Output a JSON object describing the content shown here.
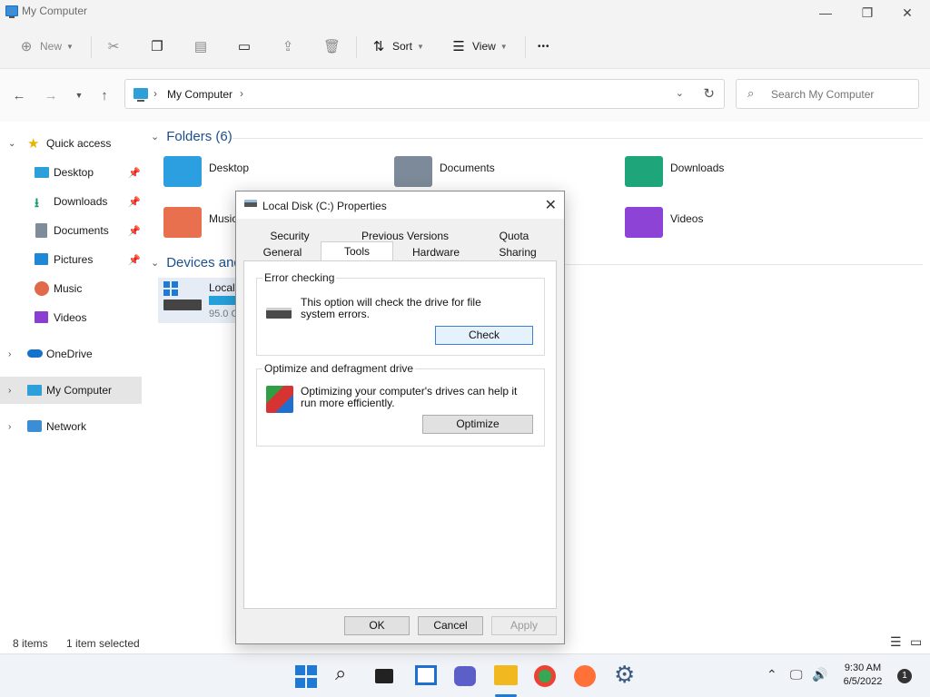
{
  "window": {
    "title": "My Computer",
    "minimize_glyph": "—",
    "maximize_glyph": "❐",
    "close_glyph": "✕"
  },
  "toolbar": {
    "new_label": "New",
    "sort_label": "Sort",
    "view_label": "View",
    "more_glyph": "•••"
  },
  "address": {
    "path": "My Computer",
    "search_placeholder": "Search My Computer"
  },
  "sidebar": {
    "items": [
      {
        "label": "Quick access",
        "icon": "star-icon"
      },
      {
        "label": "Desktop",
        "icon": "desktop-folder-icon"
      },
      {
        "label": "Downloads",
        "icon": "download-icon"
      },
      {
        "label": "Documents",
        "icon": "document-icon"
      },
      {
        "label": "Pictures",
        "icon": "pictures-icon"
      },
      {
        "label": "Music",
        "icon": "music-icon"
      },
      {
        "label": "Videos",
        "icon": "video-icon"
      },
      {
        "label": "OneDrive",
        "icon": "cloud-icon"
      },
      {
        "label": "My Computer",
        "icon": "computer-icon"
      },
      {
        "label": "Network",
        "icon": "network-icon"
      }
    ]
  },
  "content": {
    "folders_header": "Folders (6)",
    "folders": [
      {
        "name": "Desktop"
      },
      {
        "name": "Documents"
      },
      {
        "name": "Downloads"
      },
      {
        "name": "Music"
      },
      {
        "name": "Videos"
      }
    ],
    "devices_header": "Devices and",
    "drive_label": "Local",
    "drive_free": "95.0 G"
  },
  "statusbar": {
    "items_count": "8 items",
    "selection": "1 item selected"
  },
  "dialog": {
    "title": "Local Disk (C:) Properties",
    "tabs_row1": [
      "Security",
      "Previous Versions",
      "Quota"
    ],
    "tabs_row2": [
      "General",
      "Tools",
      "Hardware",
      "Sharing"
    ],
    "active_tab": "Tools",
    "error_checking": {
      "title": "Error checking",
      "text": "This option will check the drive for file system errors.",
      "button": "Check"
    },
    "optimize": {
      "title": "Optimize and defragment drive",
      "text": "Optimizing your computer's drives can help it run more efficiently.",
      "button": "Optimize"
    },
    "ok": "OK",
    "cancel": "Cancel",
    "apply": "Apply"
  },
  "taskbar": {
    "time": "9:30 AM",
    "date": "6/5/2022",
    "notification_count": "1"
  },
  "colors": {
    "accent": "#1f7ad6",
    "selected_nav": "#e5e5e5",
    "group_header": "#1d4f8a"
  }
}
